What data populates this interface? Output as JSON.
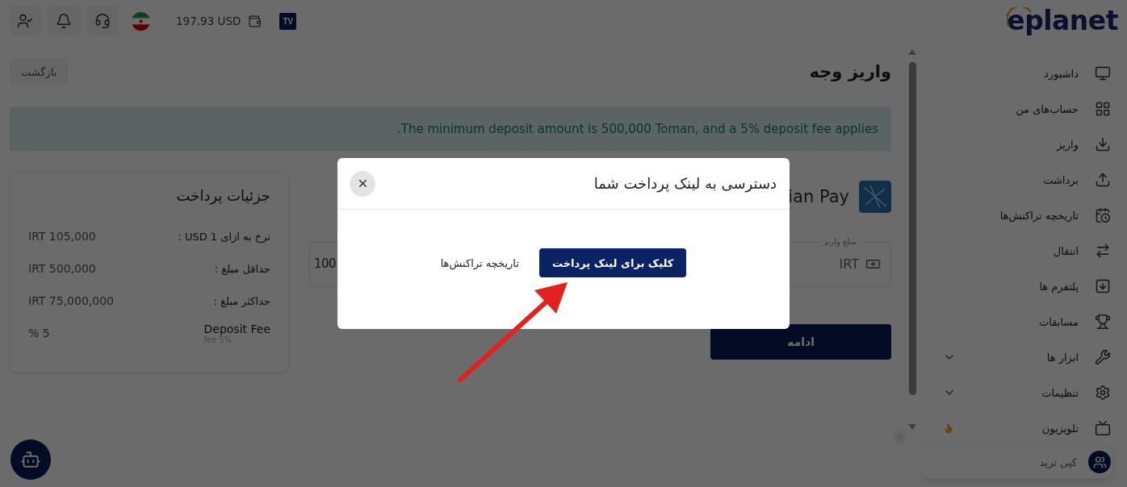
{
  "topbar": {
    "balance": "197.93 USD",
    "tv_badge": "TV",
    "brand": "eplanet"
  },
  "sidebar": {
    "items": [
      {
        "label": "داشبورد",
        "expandable": false,
        "hot": false,
        "selected": false
      },
      {
        "label": "حساب‌های من",
        "expandable": false,
        "hot": false,
        "selected": false
      },
      {
        "label": "واریز",
        "expandable": false,
        "hot": false,
        "selected": false
      },
      {
        "label": "برداشت",
        "expandable": false,
        "hot": false,
        "selected": false
      },
      {
        "label": "تاریخچه تراکنش‌ها",
        "expandable": false,
        "hot": false,
        "selected": false
      },
      {
        "label": "انتقال",
        "expandable": false,
        "hot": false,
        "selected": false
      },
      {
        "label": "پلتفرم ها",
        "expandable": false,
        "hot": false,
        "selected": false
      },
      {
        "label": "مسابقات",
        "expandable": false,
        "hot": false,
        "selected": false
      },
      {
        "label": "ابزار ها",
        "expandable": true,
        "hot": false,
        "selected": false
      },
      {
        "label": "تنظیمات",
        "expandable": true,
        "hot": false,
        "selected": false
      },
      {
        "label": "تلویزیون",
        "expandable": false,
        "hot": true,
        "selected": false
      },
      {
        "label": "کپی ترید",
        "expandable": false,
        "hot": false,
        "selected": true
      }
    ]
  },
  "page": {
    "title": "واریز وجه",
    "back_button": "بازگشت",
    "notice": ".The minimum deposit amount is 500,000 Toman, and a 5% deposit fee applies"
  },
  "payment_details": {
    "title": "جزئیات پرداخت",
    "rows": [
      {
        "label": "نرخ به ازای 1 USD :",
        "value": "IRT 105,000"
      },
      {
        "label": "حداقل مبلغ :",
        "value": "IRT 500,000"
      },
      {
        "label": "حداکثر مبلغ :",
        "value": "IRT 75,000,000"
      },
      {
        "label": "Deposit Fee",
        "note": "fee 5%",
        "value": "% 5"
      }
    ]
  },
  "gateway": {
    "name": "ian Pay"
  },
  "amount_field": {
    "label": "مبلغ واریز",
    "currency": "IRT",
    "value": "100"
  },
  "continue_button": "ادامه",
  "modal": {
    "title": "دسترسی به لینک پرداخت شما",
    "primary_button": "کلیک برای لینک پرداخت",
    "secondary_link": "تاریخچه تراکنش‌ها"
  }
}
